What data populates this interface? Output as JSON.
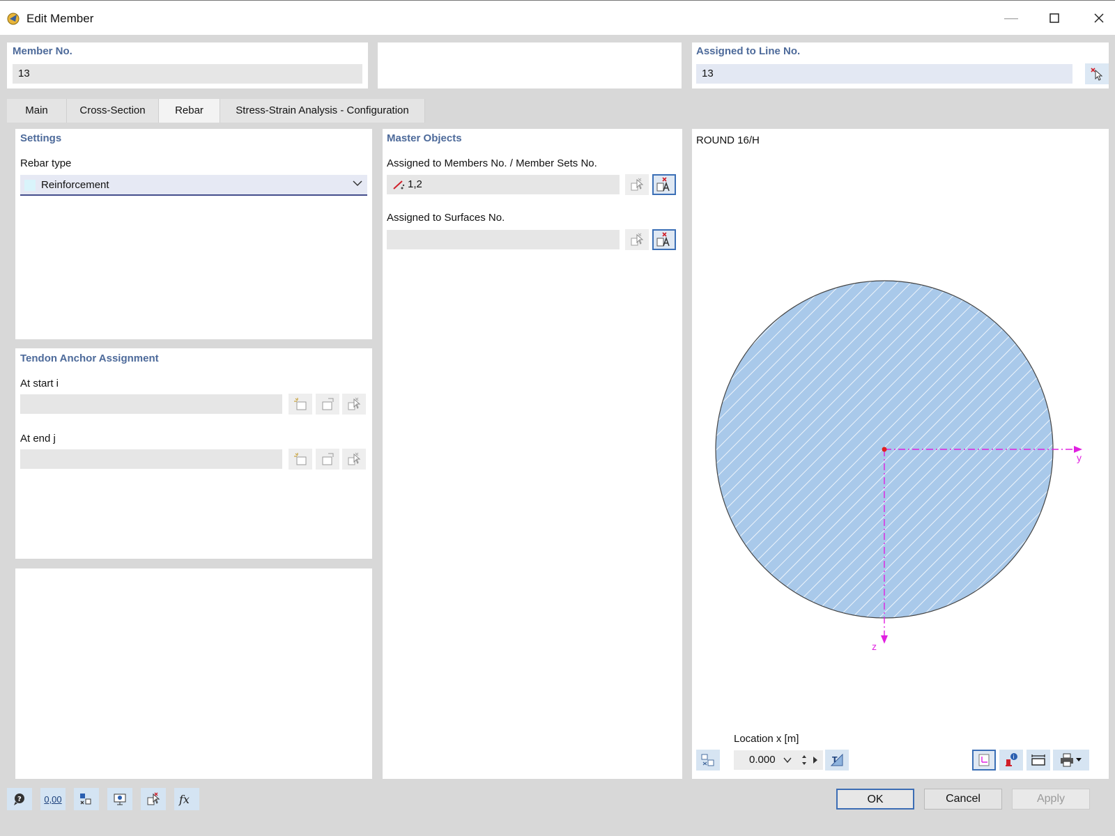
{
  "window": {
    "title": "Edit Member"
  },
  "header": {
    "member_no_label": "Member No.",
    "member_no_value": "13",
    "line_label": "Assigned to Line No.",
    "line_value": "13"
  },
  "tabs": [
    {
      "label": "Main"
    },
    {
      "label": "Cross-Section"
    },
    {
      "label": "Rebar",
      "active": true
    },
    {
      "label": "Stress-Strain Analysis - Configuration"
    }
  ],
  "settings": {
    "title": "Settings",
    "rebar_type_label": "Rebar type",
    "rebar_type_value": "Reinforcement"
  },
  "tendon": {
    "title": "Tendon Anchor Assignment",
    "start_label": "At start i",
    "start_value": "",
    "end_label": "At end j",
    "end_value": ""
  },
  "master": {
    "title": "Master Objects",
    "members_label": "Assigned to Members No. / Member Sets No.",
    "members_value": "1,2",
    "surfaces_label": "Assigned to Surfaces No.",
    "surfaces_value": ""
  },
  "preview": {
    "section_name": "ROUND 16/H",
    "axis_y": "y",
    "axis_z": "z",
    "location_label": "Location x [m]",
    "location_value": "0.000",
    "fill_color": "#a9c9ea",
    "axis_color": "#e020e0"
  },
  "footer": {
    "ok": "OK",
    "cancel": "Cancel",
    "apply": "Apply",
    "number_tool": "0,00"
  }
}
